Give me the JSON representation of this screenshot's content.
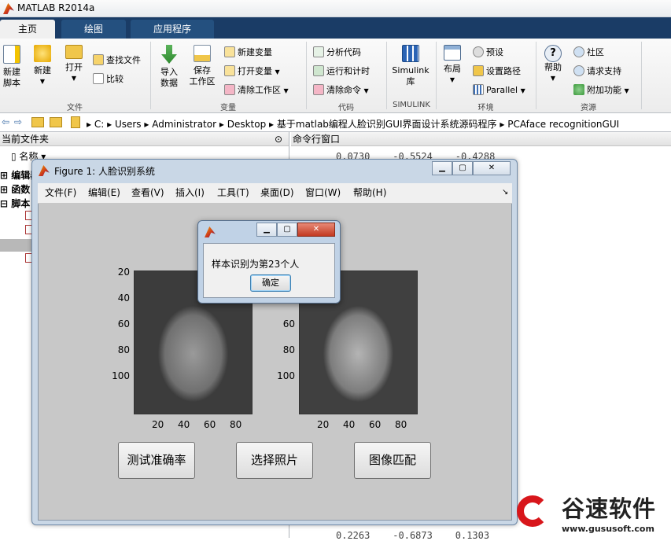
{
  "app": {
    "title": "MATLAB R2014a"
  },
  "tabs": [
    {
      "label": "主页"
    },
    {
      "label": "绘图"
    },
    {
      "label": "应用程序"
    }
  ],
  "ribbon": {
    "file": {
      "new_script": "新建\n脚本",
      "new": "新建",
      "open": "打开",
      "find_files": "查找文件",
      "compare": "比较",
      "section": "文件"
    },
    "variable": {
      "import": "导入\n数据",
      "save": "保存\n工作区",
      "new_var": "新建变量",
      "open_var": "打开变量",
      "clear_ws": "清除工作区",
      "section": "变量"
    },
    "code": {
      "analyze": "分析代码",
      "run_time": "运行和计时",
      "clear_cmd": "清除命令",
      "section": "代码"
    },
    "simulink": {
      "label": "Simulink\n库",
      "section": "SIMULINK"
    },
    "env": {
      "layout": "布局",
      "prefs": "预设",
      "set_path": "设置路径",
      "parallel": "Parallel",
      "section": "环境"
    },
    "resources": {
      "help": "帮助",
      "community": "社区",
      "support": "请求支持",
      "addons": "附加功能",
      "section": "资源"
    }
  },
  "address": {
    "crumbs": [
      "C:",
      "Users",
      "Administrator",
      "Desktop",
      "基于matlab编程人脸识别GUI界面设计系统源码程序",
      "PCAface recognitionGUI"
    ]
  },
  "left_panel": {
    "title": "当前文件夹",
    "column": "名称",
    "tree": [
      "编辑器",
      "函数",
      "脚本"
    ]
  },
  "cmd": {
    "title": "命令行窗口",
    "top_values": [
      "0.0730",
      "-0.5524",
      "-0.4288"
    ],
    "bottom_values": [
      "0.2263",
      "-0.6873",
      "0.1303"
    ]
  },
  "figure": {
    "title": "Figure 1: 人脸识别系统",
    "menu": [
      "文件(F)",
      "编辑(E)",
      "查看(V)",
      "插入(I)",
      "工具(T)",
      "桌面(D)",
      "窗口(W)",
      "帮助(H)"
    ],
    "yticks": [
      "20",
      "40",
      "60",
      "80",
      "100"
    ],
    "xticks": [
      "20",
      "40",
      "60",
      "80"
    ],
    "buttons": {
      "accuracy": "测试准确率",
      "select": "选择照片",
      "match": "图像匹配"
    }
  },
  "dialog": {
    "message": "样本识别为第23个人",
    "ok": "确定"
  },
  "watermark": {
    "brand": "谷速软件",
    "url": "www.gususoft.com"
  }
}
